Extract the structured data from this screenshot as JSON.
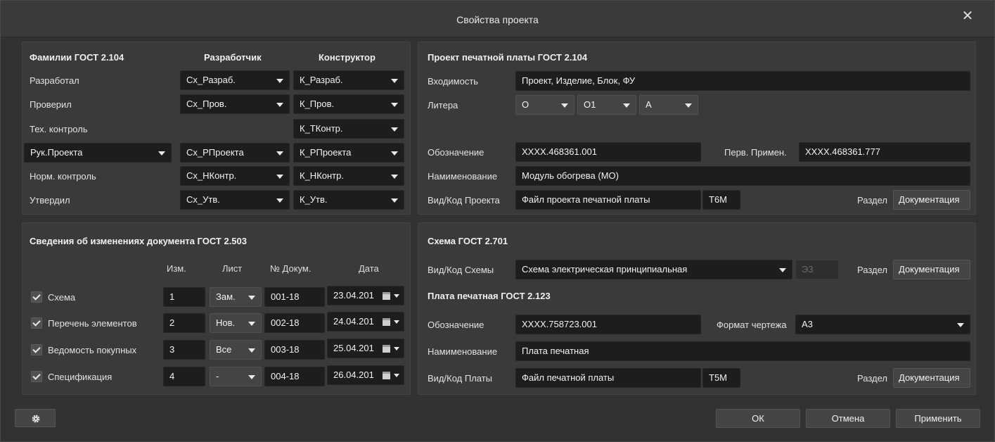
{
  "window": {
    "title": "Свойства проекта",
    "close_glyph": "✕"
  },
  "gost2104": {
    "header": "Фамилии ГОСТ 2.104",
    "col_dev": "Разработчик",
    "col_con": "Конструктор",
    "rows": [
      {
        "label": "Разработал",
        "dev": "Сх_Разраб.",
        "con": "К_Разраб."
      },
      {
        "label": "Проверил",
        "dev": "Сх_Пров.",
        "con": "К_Пров."
      },
      {
        "label": "Тех. контроль",
        "dev": "",
        "con": "К_ТКонтр."
      },
      {
        "label": "Рук.Проекта",
        "dev": "Сх_РПроекта",
        "con": "К_РПроекта"
      },
      {
        "label": "Норм. контроль",
        "dev": "Сх_НКонтр.",
        "con": "К_НКонтр."
      },
      {
        "label": "Утвердил",
        "dev": "Сх_Утв.",
        "con": "К_Утв."
      }
    ]
  },
  "pcb_project": {
    "header": "Проект печатной платы ГОСТ 2.104",
    "vhodimost_label": "Входимость",
    "vhodimost_value": "Проект, Изделие, Блок, ФУ",
    "litera_label": "Литера",
    "litera": [
      "О",
      "О1",
      "А"
    ],
    "oboznachenie_label": "Обозначение",
    "oboznachenie_value": "XXXX.468361.001",
    "perv_label": "Перв. Примен.",
    "perv_value": "XXXX.468361.777",
    "naim_label": "Намименование",
    "naim_value": "Модуль обогрева (МО)",
    "vid_label": "Вид/Код Проекта",
    "vid_value": "Файл проекта печатной платы",
    "kod_value": "Т6М",
    "razdel_label": "Раздел",
    "razdel_value": "Документация"
  },
  "changes": {
    "header": "Сведения об изменениях документа ГОСТ 2.503",
    "col_izm": "Изм.",
    "col_list": "Лист",
    "col_doc": "№ Докум.",
    "col_date": "Дата",
    "rows": [
      {
        "name": "Схема",
        "izm": "1",
        "list": "Зам.",
        "doc": "001-18",
        "date": "23.04.201"
      },
      {
        "name": "Перечень элементов",
        "izm": "2",
        "list": "Нов.",
        "doc": "002-18",
        "date": "24.04.201"
      },
      {
        "name": "Ведомость покупных",
        "izm": "3",
        "list": "Все",
        "doc": "003-18",
        "date": "25.04.201"
      },
      {
        "name": "Спецификация",
        "izm": "4",
        "list": "-",
        "doc": "004-18",
        "date": "26.04.201"
      }
    ]
  },
  "schema": {
    "header": "Схема ГОСТ 2.701",
    "vid_label": "Вид/Код Схемы",
    "vid_value": "Схема электрическая принципиальная",
    "kod_value": "Э3",
    "razdel_label": "Раздел",
    "razdel_value": "Документация",
    "board_header": "Плата печатная ГОСТ 2.123",
    "obozn_label": "Обозначение",
    "obozn_value": "XXXX.758723.001",
    "format_label": "Формат чертежа",
    "format_value": "А3",
    "naim_label": "Намименование",
    "naim_value": "Плата печатная",
    "vid_plata_label": "Вид/Код Платы",
    "vid_plata_value": "Файл печатной платы",
    "kod_plata_value": "Т5М",
    "razdel2_label": "Раздел",
    "razdel2_value": "Документация"
  },
  "footer": {
    "ok": "ОК",
    "cancel": "Отмена",
    "apply": "Применить",
    "settings_icon": "gear-icon"
  }
}
